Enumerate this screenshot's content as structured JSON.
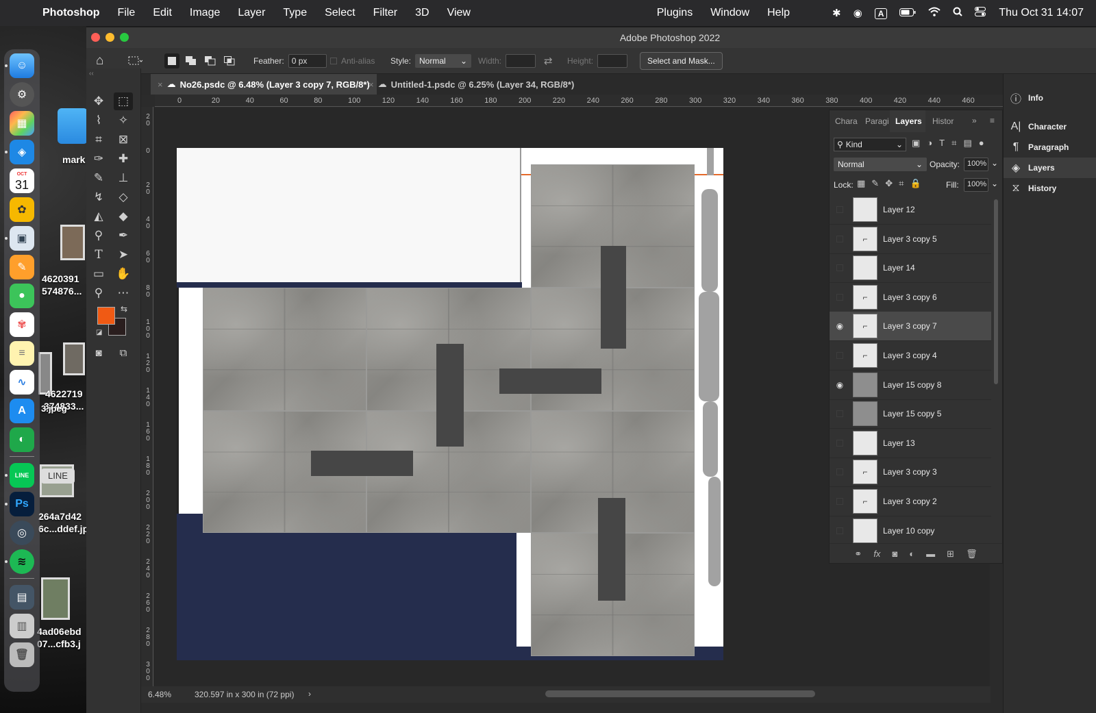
{
  "menubar": {
    "apple": "",
    "app_name": "Photoshop",
    "items": [
      "File",
      "Edit",
      "Image",
      "Layer",
      "Type",
      "Select",
      "Filter",
      "3D",
      "View"
    ],
    "plugins": "Plugins",
    "window": "Window",
    "help": "Help",
    "input_source": "A",
    "clock": "Thu Oct 31  14:07"
  },
  "desktop": {
    "labels": [
      "mark",
      "4620391",
      "574876...",
      "4622719",
      "374833...",
      "3.jpeg",
      "264a7d42",
      "6c...ddef.jp",
      "4ad06ebd",
      "07...cfb3.j"
    ],
    "line_badge": "LINE"
  },
  "dock": {
    "calendar_month": "OCT",
    "calendar_day": "31",
    "ps_label": "Ps"
  },
  "window": {
    "title": "Adobe Photoshop 2022"
  },
  "options": {
    "feather_label": "Feather:",
    "feather_value": "0 px",
    "antialias_label": "Anti-alias",
    "style_label": "Style:",
    "style_value": "Normal",
    "width_label": "Width:",
    "height_label": "Height:",
    "select_mask": "Select and Mask..."
  },
  "tabs": [
    {
      "label": "No26.psdc @ 6.48% (Layer 3 copy 7, RGB/8*)"
    },
    {
      "label": "Untitled-1.psdc @ 6.25% (Layer 34, RGB/8*)"
    }
  ],
  "ruler": {
    "h_ticks": [
      "0",
      "20",
      "40",
      "60",
      "80",
      "100",
      "120",
      "140",
      "160",
      "180",
      "200",
      "220",
      "240",
      "260",
      "280",
      "300",
      "320",
      "340",
      "360",
      "380",
      "400",
      "420",
      "440",
      "460"
    ],
    "v_ticks": [
      "2 0",
      "0",
      "2 0",
      "4 0",
      "6 0",
      "8 0",
      "1 0 0",
      "1 2 0",
      "1 4 0",
      "1 6 0",
      "1 8 0",
      "2 0 0",
      "2 2 0",
      "2 4 0",
      "2 6 0",
      "2 8 0",
      "3 0 0"
    ]
  },
  "status": {
    "zoom": "6.48%",
    "doc_size": "320.597 in x 300 in (72 ppi)",
    "arrow": "›"
  },
  "layers_panel": {
    "tabs": [
      "Chara",
      "Paragi",
      "Layers",
      "Histor"
    ],
    "kind_label": "Kind",
    "blend_mode": "Normal",
    "opacity_label": "Opacity:",
    "opacity_value": "100%",
    "lock_label": "Lock:",
    "fill_label": "Fill:",
    "fill_value": "100%",
    "layers": [
      {
        "name": "Layer 12",
        "visible": false
      },
      {
        "name": "Layer 3 copy 5",
        "visible": false
      },
      {
        "name": "Layer 14",
        "visible": false
      },
      {
        "name": "Layer 3 copy 6",
        "visible": false
      },
      {
        "name": "Layer 3 copy 7",
        "visible": true
      },
      {
        "name": "Layer 3 copy 4",
        "visible": false
      },
      {
        "name": "Layer 15 copy 8",
        "visible": true
      },
      {
        "name": "Layer 15 copy 5",
        "visible": false
      },
      {
        "name": "Layer 13",
        "visible": false
      },
      {
        "name": "Layer 3 copy 3",
        "visible": false
      },
      {
        "name": "Layer 3 copy 2",
        "visible": false
      },
      {
        "name": "Layer 10 copy",
        "visible": false
      }
    ],
    "footer_fx": "fx"
  },
  "side_panels": {
    "info": "Info",
    "character": "Character",
    "paragraph": "Paragraph",
    "layers": "Layers",
    "history": "History"
  },
  "colors": {
    "foreground": "#f05a14",
    "background": "#2a1e1e",
    "navy": "#252d4d",
    "accent_line": "#e56a2a"
  }
}
